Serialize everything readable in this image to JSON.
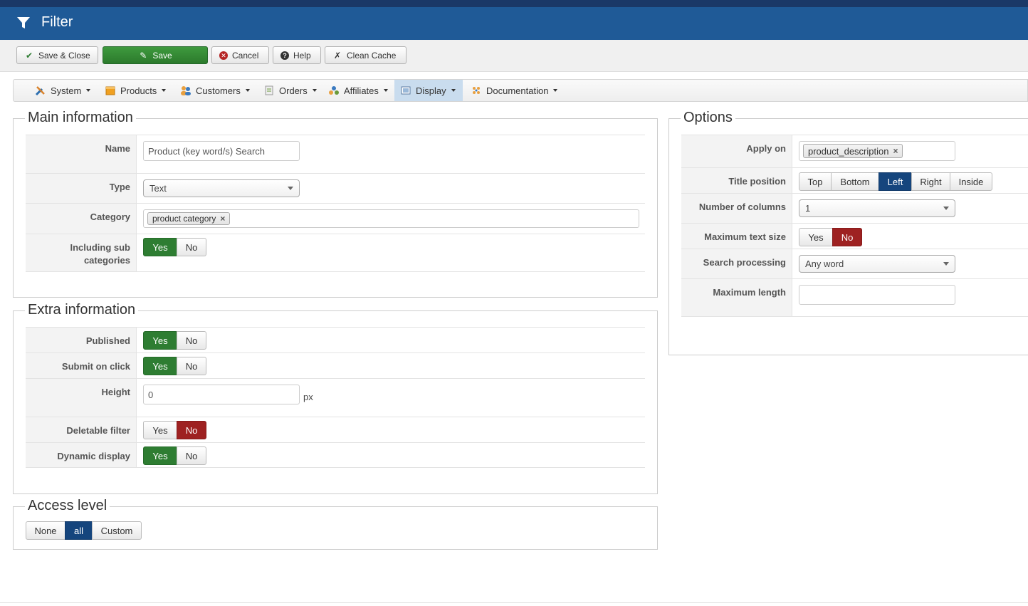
{
  "header": {
    "title": "Filter",
    "icon": "filter-icon"
  },
  "toolbar": {
    "save_close": "Save & Close",
    "save": "Save",
    "cancel": "Cancel",
    "help": "Help",
    "clean_cache": "Clean Cache"
  },
  "menu": {
    "items": [
      {
        "label": "System",
        "icon": "tools-icon"
      },
      {
        "label": "Products",
        "icon": "box-icon"
      },
      {
        "label": "Customers",
        "icon": "users-icon"
      },
      {
        "label": "Orders",
        "icon": "orders-icon"
      },
      {
        "label": "Affiliates",
        "icon": "affiliates-icon"
      },
      {
        "label": "Display",
        "icon": "display-icon"
      },
      {
        "label": "Documentation",
        "icon": "documentation-icon"
      }
    ],
    "active": "Display"
  },
  "main_info": {
    "legend": "Main information",
    "name_label": "Name",
    "name_value": "Product (key word/s) Search",
    "type_label": "Type",
    "type_value": "Text",
    "category_label": "Category",
    "category_tag": "product category",
    "subcat_label": "Including sub categories",
    "subcat_yes": "Yes",
    "subcat_no": "No",
    "subcat_selected": "Yes"
  },
  "extra_info": {
    "legend": "Extra information",
    "published_label": "Published",
    "published_selected": "Yes",
    "submit_label": "Submit on click",
    "submit_selected": "Yes",
    "height_label": "Height",
    "height_value": "0",
    "height_unit": "px",
    "deletable_label": "Deletable filter",
    "deletable_selected": "No",
    "dynamic_label": "Dynamic display",
    "dynamic_selected": "Yes",
    "yes": "Yes",
    "no": "No"
  },
  "access": {
    "legend": "Access level",
    "options": [
      "None",
      "all",
      "Custom"
    ],
    "selected": "all"
  },
  "options": {
    "legend": "Options",
    "apply_label": "Apply on",
    "apply_tag": "product_description",
    "title_pos_label": "Title position",
    "title_pos_options": [
      "Top",
      "Bottom",
      "Left",
      "Right",
      "Inside"
    ],
    "title_pos_selected": "Left",
    "columns_label": "Number of columns",
    "columns_value": "1",
    "max_text_label": "Maximum text size",
    "max_text_selected": "No",
    "search_label": "Search processing",
    "search_value": "Any word",
    "max_length_label": "Maximum length",
    "max_length_value": "",
    "yes": "Yes",
    "no": "No"
  },
  "colors": {
    "header": "#1f5a97",
    "green": "#2e7d32",
    "red": "#9e2121",
    "blue": "#15457d"
  }
}
